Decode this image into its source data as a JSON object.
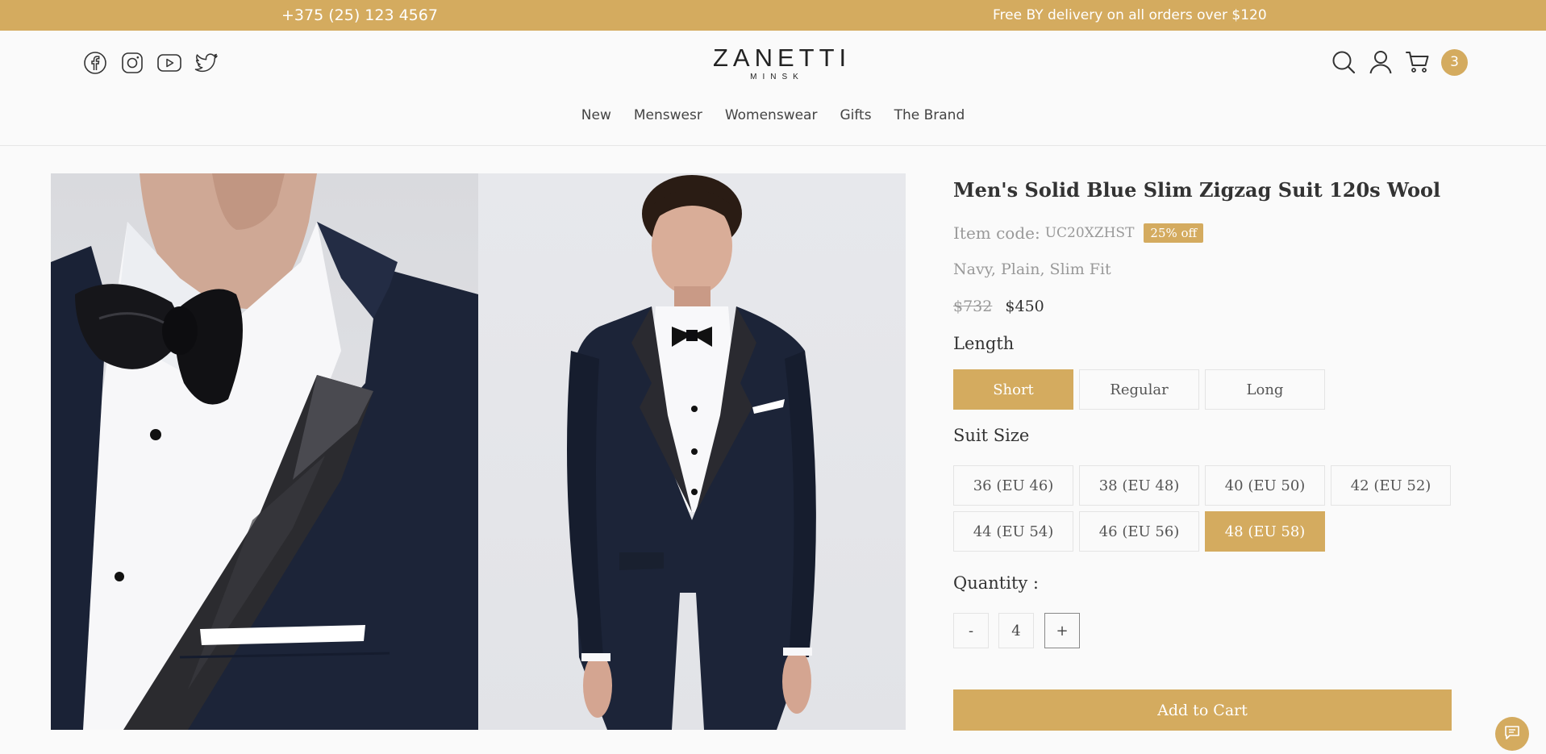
{
  "topbar": {
    "phone": "+375 (25) 123 4567",
    "promo": "Free BY delivery on all orders over $120"
  },
  "header": {
    "social_icons": [
      "facebook-icon",
      "instagram-icon",
      "youtube-icon",
      "twitter-icon"
    ],
    "logo_brand": "ZANETTI",
    "logo_city": "MINSK",
    "tool_icons": [
      "search-icon",
      "account-icon",
      "cart-icon"
    ],
    "cart_count": "3"
  },
  "nav": {
    "items": [
      {
        "label": "New"
      },
      {
        "label": "Menswesr"
      },
      {
        "label": "Womenswear"
      },
      {
        "label": "Gifts"
      },
      {
        "label": "The Brand"
      }
    ]
  },
  "product": {
    "title": "Men's Solid Blue Slim Zigzag Suit 120s Wool",
    "code_label": "Item code:",
    "code_value": "UC20XZHST",
    "discount_badge": "25% off",
    "attributes": "Navy, Plain, Slim Fit",
    "price_old": "$732",
    "price_new": "$450",
    "length_label": "Length",
    "length_options": [
      {
        "label": "Short",
        "selected": true
      },
      {
        "label": "Regular",
        "selected": false
      },
      {
        "label": "Long",
        "selected": false
      }
    ],
    "size_label": "Suit Size",
    "size_options": [
      {
        "label": "36 (EU 46)",
        "selected": false
      },
      {
        "label": "38 (EU 48)",
        "selected": false
      },
      {
        "label": "40 (EU 50)",
        "selected": false
      },
      {
        "label": "42 (EU 52)",
        "selected": false
      },
      {
        "label": "44 (EU 54)",
        "selected": false
      },
      {
        "label": "46 (EU 56)",
        "selected": false
      },
      {
        "label": "48 (EU 58)",
        "selected": true
      }
    ],
    "quantity_label": "Quantity :",
    "quantity_minus": "-",
    "quantity_value": "4",
    "quantity_plus": "+",
    "add_to_cart": "Add to Cart"
  },
  "colors": {
    "accent": "#d4ab5f",
    "suit_navy": "#1c2438"
  }
}
